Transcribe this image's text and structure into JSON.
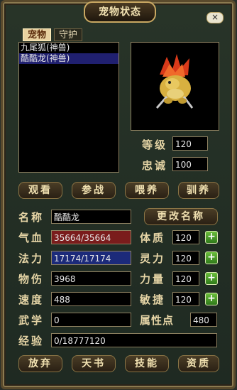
{
  "window": {
    "title": "宠物状态",
    "close_glyph": "×"
  },
  "tabs": [
    {
      "label": "宠物"
    },
    {
      "label": "守护"
    }
  ],
  "pet_list": [
    {
      "name": "九尾狐(神兽)",
      "selected": false
    },
    {
      "name": "酷酷龙(神兽)",
      "selected": true
    }
  ],
  "portrait": {
    "icon": "dragon-pet-icon"
  },
  "level": {
    "label": "等级",
    "value": "120"
  },
  "loyalty": {
    "label": "忠诚",
    "value": "100"
  },
  "actions": {
    "watch": "观看",
    "battle": "参战",
    "feed": "喂养",
    "train": "驯养"
  },
  "stats": {
    "name": {
      "label": "名称",
      "value": "酷酷龙"
    },
    "rename_button": "更改名称",
    "hp": {
      "label": "气血",
      "value": "35664/35664"
    },
    "mp": {
      "label": "法力",
      "value": "17174/17174"
    },
    "phys_attack": {
      "label": "物伤",
      "value": "3968"
    },
    "speed": {
      "label": "速度",
      "value": "488"
    },
    "martial": {
      "label": "武学",
      "value": "0"
    },
    "exp": {
      "label": "经验",
      "value": "0/18777120"
    },
    "constitution": {
      "label": "体质",
      "value": "120"
    },
    "spirit": {
      "label": "灵力",
      "value": "120"
    },
    "strength": {
      "label": "力量",
      "value": "120"
    },
    "agility": {
      "label": "敏捷",
      "value": "120"
    },
    "attr_points": {
      "label": "属性点",
      "value": "480"
    },
    "plus_glyph": "+"
  },
  "bottom": {
    "release": "放弃",
    "skills_book": "天书",
    "skills": "技能",
    "aptitude": "资质"
  },
  "colors": {
    "hp_bar": "#7a1c1c",
    "mp_bar": "#1c2a7a",
    "plus_button": "#4a9a2a",
    "selected_row": "#202070"
  }
}
